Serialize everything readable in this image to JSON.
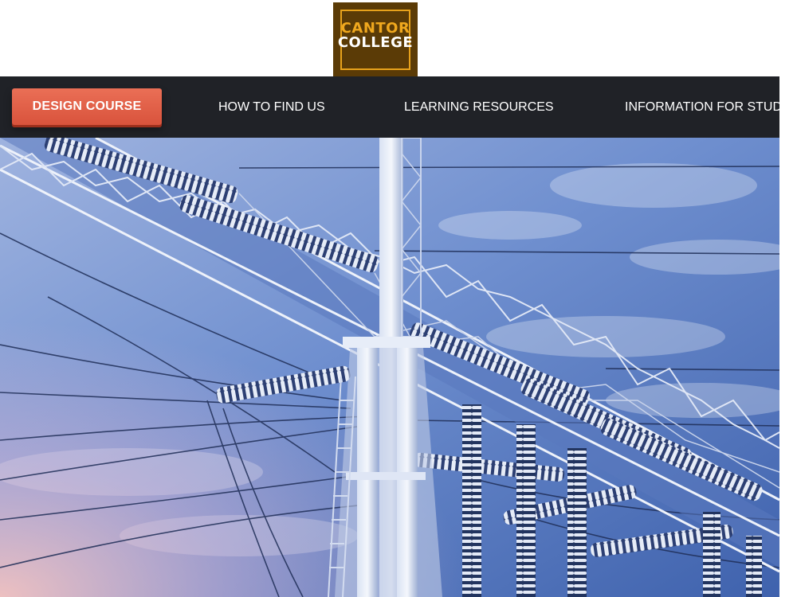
{
  "logo": {
    "line1": "CANTOR",
    "line2": "COLLEGE"
  },
  "nav": {
    "cta_label": "DESIGN COURSE",
    "links": [
      {
        "label": "HOW TO FIND US"
      },
      {
        "label": "LEARNING RESOURCES"
      },
      {
        "label": "INFORMATION FOR STUD"
      }
    ]
  },
  "hero": {
    "image": "electricity-pylon-substation-photo"
  },
  "colors": {
    "navbar_bg": "#202227",
    "cta_bg": "#e2614a",
    "logo_bg": "#5b3b06",
    "logo_accent": "#f0a81e",
    "sky_blue": "#4a6fb8"
  }
}
